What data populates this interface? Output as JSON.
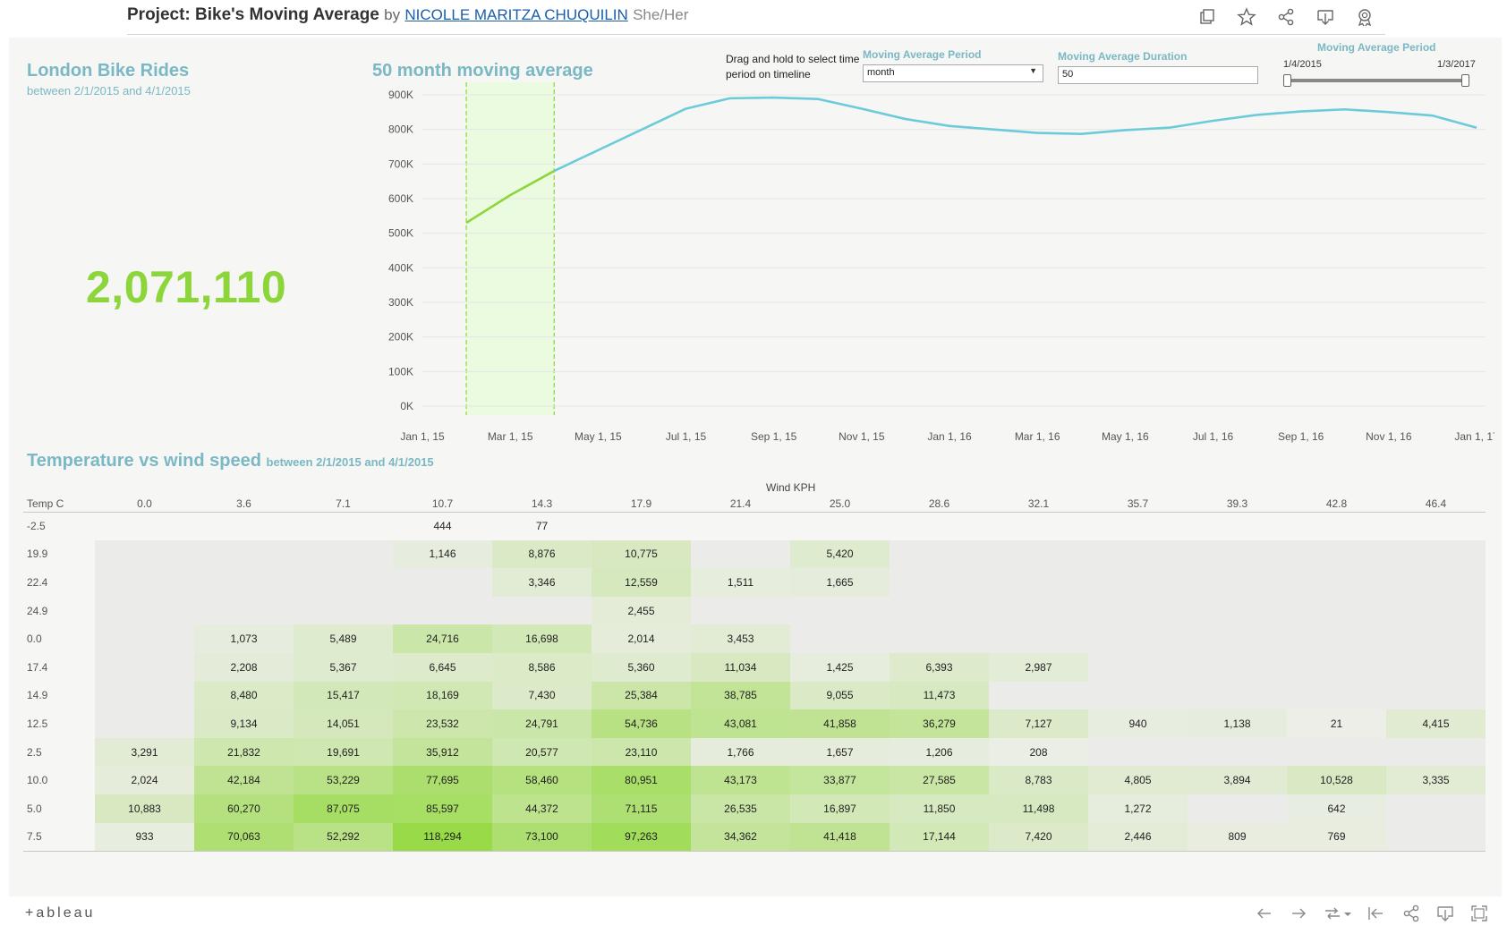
{
  "header": {
    "title_project": "Project: Bike's Moving Average",
    "title_by": "by",
    "author": "NICOLLE MARITZA CHUQUILIN",
    "pronouns": "She/Her",
    "icons": [
      "copy-icon",
      "star-icon",
      "share-icon",
      "download-icon",
      "badge-icon"
    ]
  },
  "kpi": {
    "title": "London Bike Rides",
    "subtitle": "between 2/1/2015  and 4/1/2015",
    "value": "2,071,110"
  },
  "line_chart": {
    "title": "50 month moving average",
    "instruction": "Drag and hold to select time period on timeline"
  },
  "controls": {
    "period_label": "Moving Average Period",
    "period_value": "month",
    "duration_label": "Moving Average Duration",
    "duration_value": "50",
    "slider_title": "Moving Average Period",
    "slider_low": "1/4/2015",
    "slider_high": "1/3/2017",
    "slider_range": [
      0,
      1
    ]
  },
  "heatmap": {
    "title": "Temperature vs wind speed",
    "subtitle": "between 2/1/2015 and 4/1/2015",
    "col_axis": "Wind KPH",
    "row_axis": "Temp C"
  },
  "footer": {
    "logo": "+ableau",
    "icons": [
      "undo-icon",
      "redo-icon",
      "revert-icon",
      "reset-icon",
      "share-icon",
      "download-icon",
      "fullscreen-icon"
    ]
  },
  "colors": {
    "accent_teal": "#79b8c4",
    "line_teal": "#6ccbd9",
    "line_green": "#8cd63c",
    "kpi_green": "#8cd63c",
    "highlight": "#eafbe0"
  },
  "chart_data": [
    {
      "type": "line",
      "title": "50 month moving average",
      "x": [
        "Jan 1, 15",
        "Feb 1, 15",
        "Mar 1, 15",
        "Apr 1, 15",
        "May 1, 15",
        "Jun 1, 15",
        "Jul 1, 15",
        "Aug 1, 15",
        "Sep 1, 15",
        "Oct 1, 15",
        "Nov 1, 15",
        "Dec 1, 15",
        "Jan 1, 16",
        "Feb 1, 16",
        "Mar 1, 16",
        "Apr 1, 16",
        "May 1, 16",
        "Jun 1, 16",
        "Jul 1, 16",
        "Aug 1, 16",
        "Sep 1, 16",
        "Oct 1, 16",
        "Nov 1, 16",
        "Dec 1, 16",
        "Jan 1, 17"
      ],
      "values": [
        null,
        530000,
        610000,
        680000,
        740000,
        800000,
        860000,
        890000,
        892000,
        888000,
        860000,
        830000,
        810000,
        800000,
        790000,
        787000,
        798000,
        805000,
        825000,
        842000,
        852000,
        858000,
        850000,
        840000,
        805000
      ],
      "highlight_range": [
        "Feb 1, 15",
        "Apr 1, 15"
      ],
      "x_ticks": [
        "Jan 1, 15",
        "Mar 1, 15",
        "May 1, 15",
        "Jul 1, 15",
        "Sep 1, 15",
        "Nov 1, 15",
        "Jan 1, 16",
        "Mar 1, 16",
        "May 1, 16",
        "Jul 1, 16",
        "Sep 1, 16",
        "Nov 1, 16",
        "Jan 1, 17"
      ],
      "y_ticks": [
        "0K",
        "100K",
        "200K",
        "300K",
        "400K",
        "500K",
        "600K",
        "700K",
        "800K",
        "900K"
      ],
      "ylim": [
        0,
        900000
      ],
      "grid": true
    },
    {
      "type": "heatmap",
      "title": "Temperature vs wind speed",
      "xlabel": "Wind KPH",
      "ylabel": "Temp C",
      "columns": [
        "0.0",
        "3.6",
        "7.1",
        "10.7",
        "14.3",
        "17.9",
        "21.4",
        "25.0",
        "28.6",
        "32.1",
        "35.7",
        "39.3",
        "42.8",
        "46.4"
      ],
      "rows": [
        "-2.5",
        "19.9",
        "22.4",
        "24.9",
        "0.0",
        "17.4",
        "14.9",
        "12.5",
        "2.5",
        "10.0",
        "5.0",
        "7.5"
      ],
      "values": [
        [
          null,
          null,
          null,
          444,
          77,
          null,
          null,
          null,
          null,
          null,
          null,
          null,
          null,
          null
        ],
        [
          null,
          null,
          null,
          1146,
          8876,
          10775,
          null,
          5420,
          null,
          null,
          null,
          null,
          null,
          null
        ],
        [
          null,
          null,
          null,
          null,
          3346,
          12559,
          1511,
          1665,
          null,
          null,
          null,
          null,
          null,
          null
        ],
        [
          null,
          null,
          null,
          null,
          null,
          2455,
          null,
          null,
          null,
          null,
          null,
          null,
          null,
          null
        ],
        [
          null,
          1073,
          5489,
          24716,
          16698,
          2014,
          3453,
          null,
          null,
          null,
          null,
          null,
          null,
          null
        ],
        [
          null,
          2208,
          5367,
          6645,
          8586,
          5360,
          11034,
          1425,
          6393,
          2987,
          null,
          null,
          null,
          null
        ],
        [
          null,
          8480,
          15417,
          18169,
          7430,
          25384,
          38785,
          9055,
          11473,
          null,
          null,
          null,
          null,
          null
        ],
        [
          null,
          9134,
          14051,
          23532,
          24791,
          54736,
          43081,
          41858,
          36279,
          7127,
          940,
          1138,
          21,
          4415
        ],
        [
          3291,
          21832,
          19691,
          35912,
          20577,
          23110,
          1766,
          1657,
          1206,
          208,
          null,
          null,
          null,
          null
        ],
        [
          2024,
          42184,
          53229,
          77695,
          58460,
          80951,
          43173,
          33877,
          27585,
          8783,
          4805,
          3894,
          10528,
          3335
        ],
        [
          10883,
          60270,
          87075,
          85597,
          44372,
          71115,
          26535,
          16897,
          11850,
          11498,
          1272,
          null,
          642,
          null
        ],
        [
          933,
          70063,
          52292,
          118294,
          73100,
          97263,
          34362,
          41418,
          17144,
          7420,
          2446,
          809,
          769,
          null
        ]
      ]
    }
  ]
}
